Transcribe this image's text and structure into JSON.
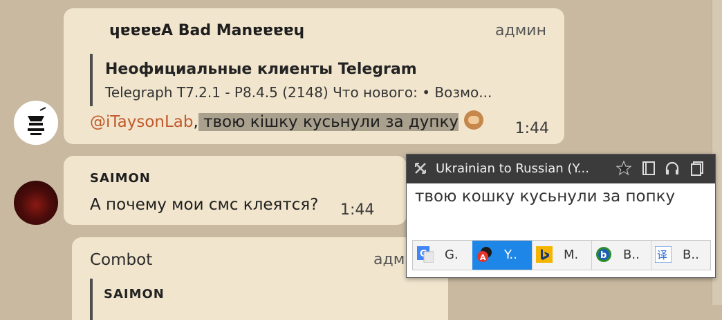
{
  "messages": [
    {
      "sender": "ɥɐɐɐɐA Bad Manɐɐɐɐɥ",
      "role": "админ",
      "reply": {
        "title": "Неофициальные клиенты Telegram",
        "text": "Telegraph T7.2.1 - P8.4.5 (2148)  Что нового: • Возмо..."
      },
      "mention": "@iTaysonLab",
      "separator": ",",
      "text": " твою кішку кусьнули за дупку",
      "time": "1:44"
    },
    {
      "sender": "SAIMON",
      "text": "А почему мои смс клеятся?",
      "time": "1:44"
    },
    {
      "sender": "Combot",
      "role": "адм",
      "reply_sender": "SAIMON"
    }
  ],
  "translator": {
    "title": "Ukrainian to Russian (Y...",
    "result": "твою кошку кусьнули за попку",
    "engines": [
      {
        "icon": "google-translate-icon",
        "label": "G.",
        "color": "#4285f4"
      },
      {
        "icon": "yandex-translate-icon",
        "label": "Y..",
        "color": "#e5332a"
      },
      {
        "icon": "bing-icon",
        "label": "M.",
        "color": "#f4b400"
      },
      {
        "icon": "babylon-icon",
        "label": "B..",
        "color": "#2c8c2c"
      },
      {
        "icon": "baidu-translate-icon",
        "label": "B..",
        "color": "#2f6fd6"
      }
    ],
    "active_engine_index": 1
  }
}
